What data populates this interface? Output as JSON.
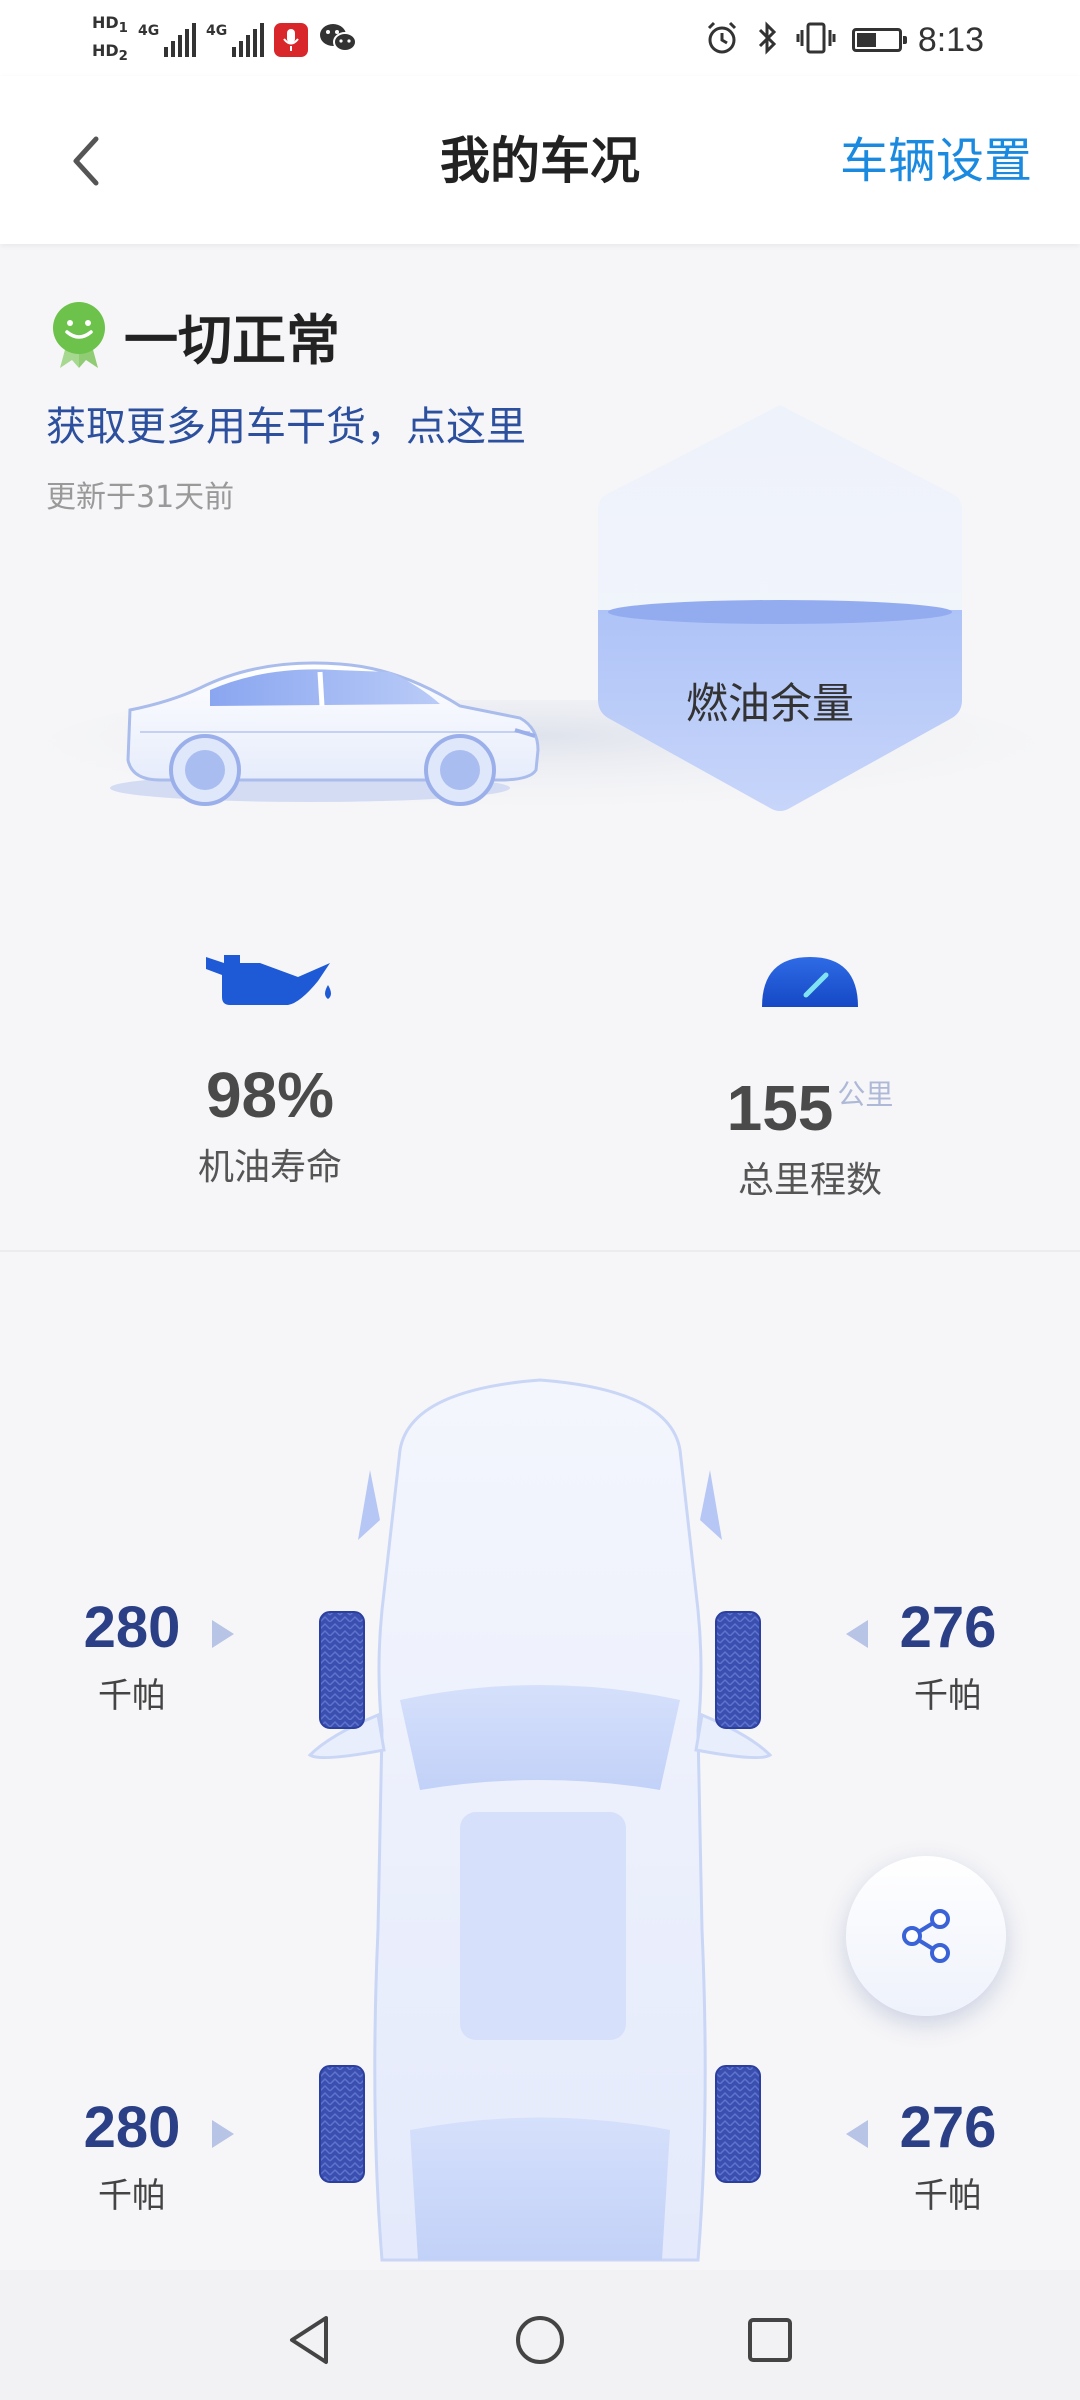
{
  "status_bar": {
    "hd1": "HD",
    "hd1_sub": "1",
    "hd2": "HD",
    "hd2_sub": "2",
    "network1": "4G",
    "network2": "4G",
    "time": "8:13"
  },
  "header": {
    "title": "我的车况",
    "settings_label": "车辆设置"
  },
  "status": {
    "text": "一切正常",
    "promo_link": "获取更多用车干货，点这里",
    "updated": "更新于31天前",
    "fuel_label": "燃油余量"
  },
  "metrics": {
    "oil": {
      "value": "98%",
      "label": "机油寿命"
    },
    "mileage": {
      "value": "155",
      "unit": "公里",
      "label": "总里程数"
    }
  },
  "tires": {
    "front_left": {
      "value": "280",
      "unit": "千帕"
    },
    "front_right": {
      "value": "276",
      "unit": "千帕"
    },
    "rear_left": {
      "value": "280",
      "unit": "千帕"
    },
    "rear_right": {
      "value": "276",
      "unit": "千帕"
    }
  },
  "colors": {
    "accent": "#1a8ae0",
    "tire_value": "#2b3f86",
    "status_green": "#6cc24a"
  },
  "icons": {
    "status": "smiley-badge-icon",
    "oil": "oil-can-icon",
    "mileage": "speedometer-icon",
    "share": "share-icon"
  }
}
